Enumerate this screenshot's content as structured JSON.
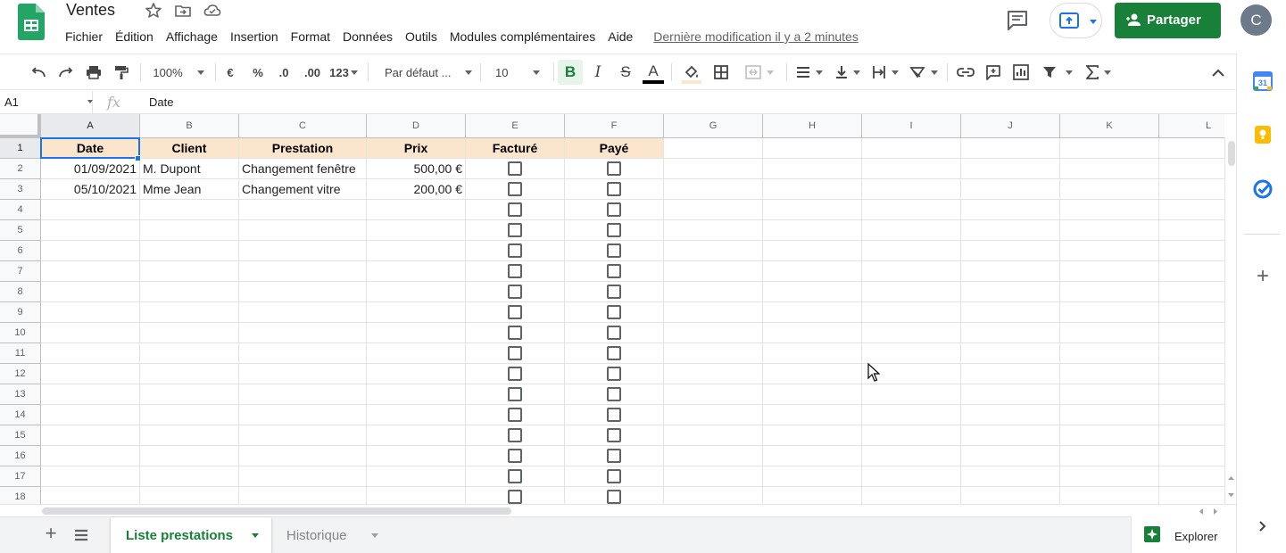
{
  "document": {
    "title": "Ventes"
  },
  "menu": [
    "Fichier",
    "Édition",
    "Affichage",
    "Insertion",
    "Format",
    "Données",
    "Outils",
    "Modules complémentaires",
    "Aide"
  ],
  "last_edit": "Dernière modification il y a 2 minutes",
  "share_label": "Partager",
  "avatar_initial": "C",
  "toolbar": {
    "zoom": "100%",
    "currency": "€",
    "percent": "%",
    "decrease_decimals": ".0",
    "increase_decimals": ".00",
    "more_formats": "123",
    "font": "Par défaut ...",
    "font_size": "10",
    "bold": "B",
    "italic": "I",
    "strikethrough": "S",
    "text_color": "A"
  },
  "formula_bar": {
    "cell_ref": "A1",
    "fx": "fx",
    "content": "Date"
  },
  "columns": [
    "A",
    "B",
    "C",
    "D",
    "E",
    "F",
    "G",
    "H",
    "I",
    "J",
    "K",
    "L"
  ],
  "rows": [
    "1",
    "2",
    "3",
    "4",
    "5",
    "6",
    "7",
    "8",
    "9",
    "10",
    "11",
    "12",
    "13",
    "14",
    "15",
    "16",
    "17",
    "18"
  ],
  "table": {
    "headers": [
      "Date",
      "Client",
      "Prestation",
      "Prix",
      "Facturé",
      "Payé"
    ],
    "rows": [
      {
        "date": "01/09/2021",
        "client": "M. Dupont",
        "prestation": "Changement fenêtre",
        "prix": "500,00 €"
      },
      {
        "date": "05/10/2021",
        "client": "Mme Jean",
        "prestation": "Changement vitre",
        "prix": "200,00 €"
      }
    ]
  },
  "sheets": {
    "add": "+",
    "active": "Liste prestations",
    "other": "Historique"
  },
  "explore_label": "Explorer",
  "side_panel": {
    "calendar_day": "31",
    "add": "+"
  },
  "colors": {
    "brand_green": "#188038",
    "header_fill": "#fce5cd",
    "selection": "#1a73e8"
  }
}
